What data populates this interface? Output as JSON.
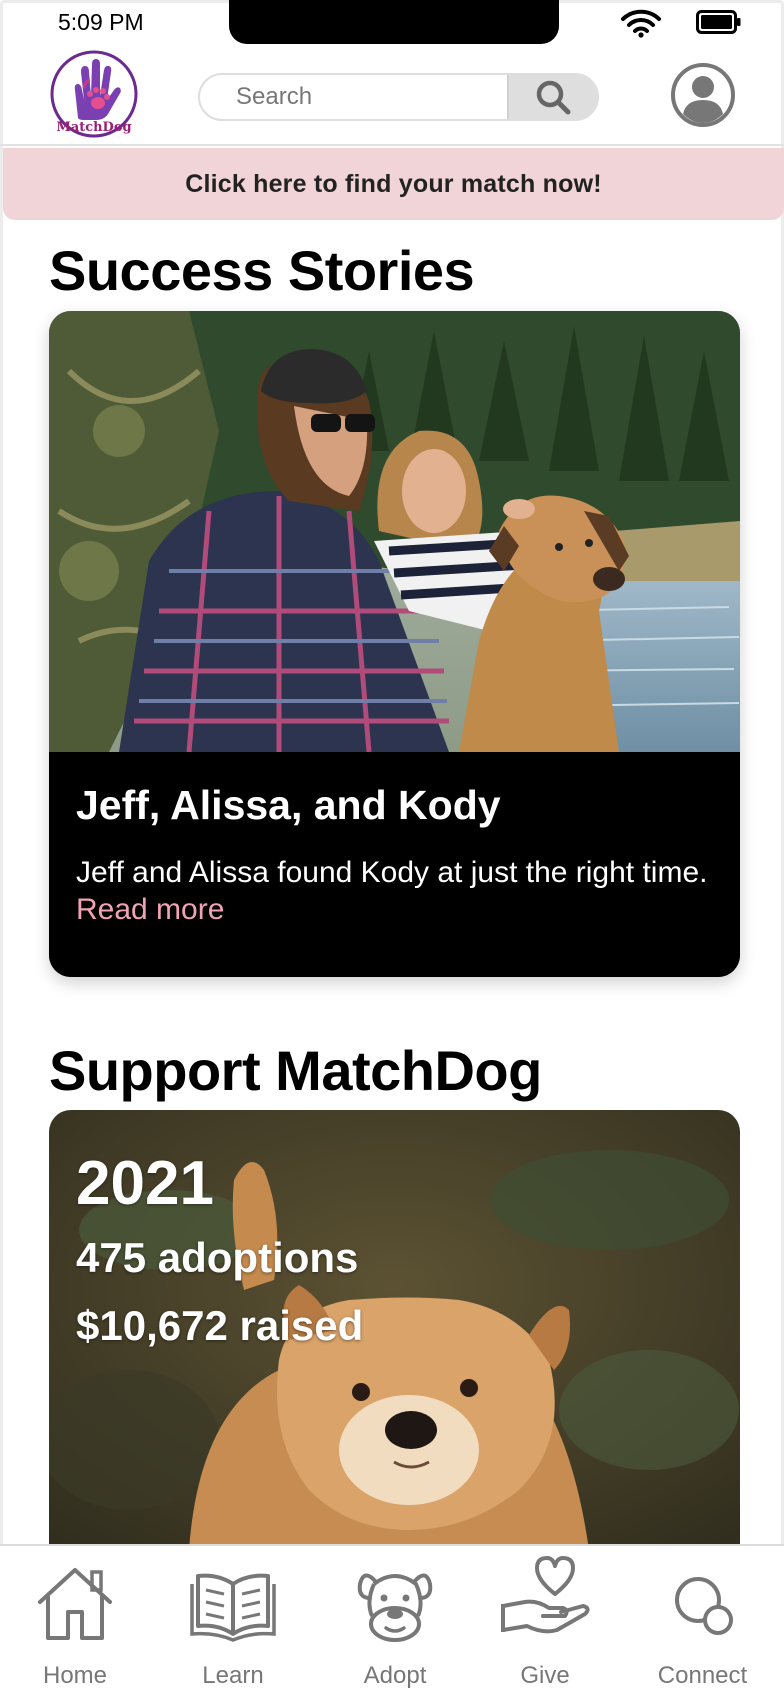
{
  "status_bar": {
    "time": "5:09 PM"
  },
  "header": {
    "logo_text": "MatchDog",
    "search": {
      "placeholder": "Search",
      "value": ""
    }
  },
  "banner": {
    "text": "Click here to find your match now!"
  },
  "success_stories": {
    "title": "Success Stories",
    "story": {
      "name": "Jeff, Alissa, and Kody",
      "text": "Jeff and Alissa found Kody at just the right time.",
      "link": "Read more"
    }
  },
  "support": {
    "title": "Support MatchDog",
    "year": "2021",
    "adoptions": "475 adoptions",
    "raised": "$10,672 raised"
  },
  "nav": {
    "items": [
      {
        "label": "Home",
        "icon": "home-icon"
      },
      {
        "label": "Learn",
        "icon": "book-icon"
      },
      {
        "label": "Adopt",
        "icon": "dog-icon"
      },
      {
        "label": "Give",
        "icon": "heart-hand-icon"
      },
      {
        "label": "Connect",
        "icon": "chat-bubbles-icon"
      }
    ]
  },
  "colors": {
    "banner_bg": "#f0d4d8",
    "link": "#f0a3b4",
    "brand_purple": "#6b2a90",
    "brand_pink": "#c2398a",
    "nav_gray": "#777777"
  }
}
